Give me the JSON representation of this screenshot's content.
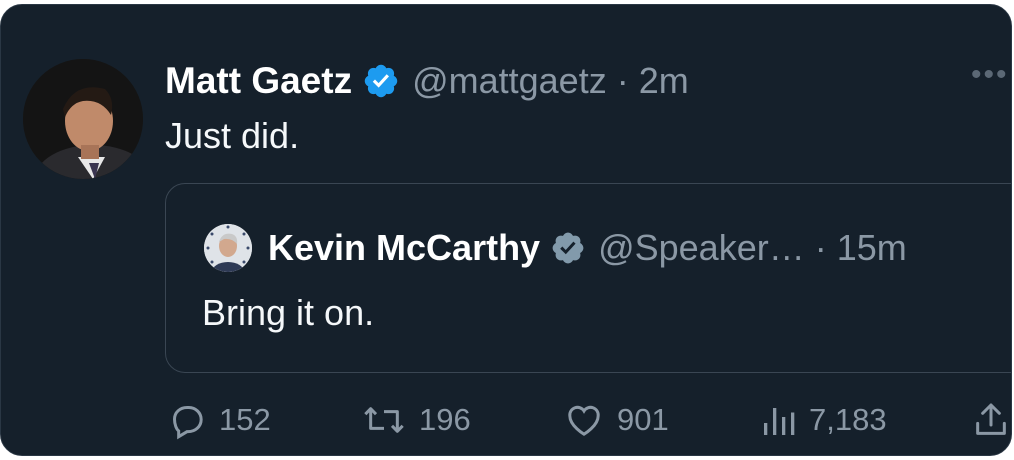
{
  "tweet": {
    "author_name": "Matt Gaetz",
    "handle_time": "@mattgaetz · 2m",
    "text": "Just did.",
    "more_label": "•••"
  },
  "quoted": {
    "author_name": "Kevin McCarthy",
    "handle_time": "@Speaker… · 15m",
    "text": "Bring it on."
  },
  "actions": {
    "replies": "152",
    "retweets": "196",
    "likes": "901",
    "views": "7,183"
  },
  "colors": {
    "background": "#15202b",
    "verified": "#1d9bf0",
    "verified_gov": "#829aab",
    "muted": "#8b98a5"
  },
  "icons": [
    "verified-badge-icon",
    "more-icon",
    "reply-icon",
    "retweet-icon",
    "like-icon",
    "views-icon",
    "share-icon"
  ]
}
